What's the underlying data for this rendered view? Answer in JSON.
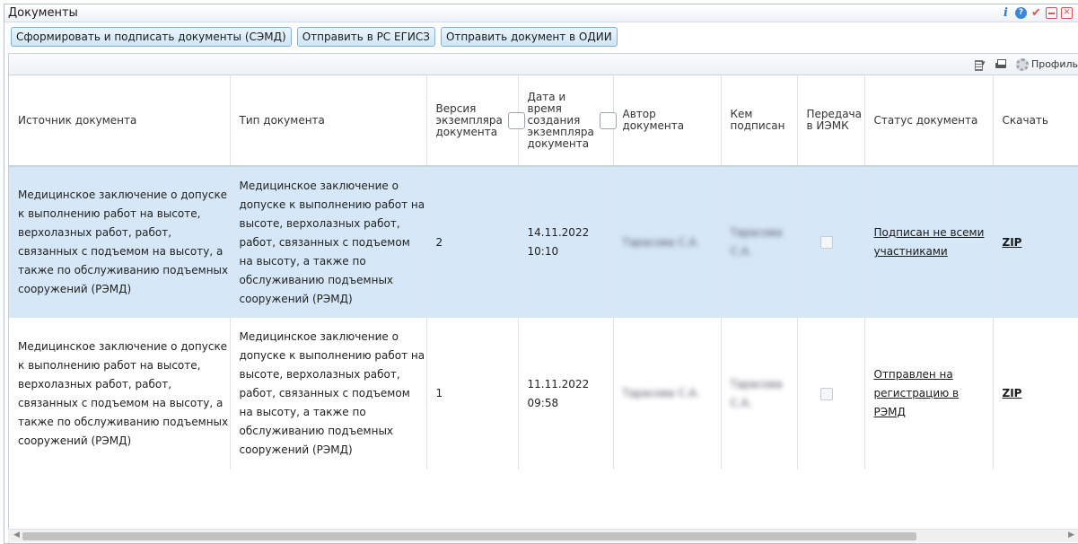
{
  "window": {
    "title": "Документы"
  },
  "actions": {
    "form_sign": "Сформировать и подписать документы (СЭМД)",
    "send_egisz": "Отправить в РС ЕГИСЗ",
    "send_odii": "Отправить документ в ОДИИ"
  },
  "grid_toolbar": {
    "profile_label": "Профиль"
  },
  "columns": {
    "source": "Источник документа",
    "type": "Тип документа",
    "version": "Версия экземпляра документа",
    "created": "Дата и время создания экземпляра документа",
    "author": "Автор документа",
    "signed_by": "Кем подписан",
    "iemk": "Передача в ИЭМК",
    "status": "Статус документа",
    "download": "Скачать"
  },
  "rows": [
    {
      "source": "Медицинское заключение о допуске к выполнению работ на высоте, верхолазных работ, работ, связанных с подъемом на высоту, а также по обслуживанию подъемных сооружений (РЭМД)",
      "type": "Медицинское заключение о допуске к выполнению работ на высоте, верхолазных работ, работ, связанных с подъемом на высоту, а также по обслуживанию подъемных сооружений (РЭМД)",
      "version": "2",
      "date": "14.11.2022",
      "time": "10:10",
      "author": "Тарасова С.А.",
      "signed_by": "Тарасова С.А.",
      "status": "Подписан не всеми участниками",
      "download": "ZIP",
      "selected": true
    },
    {
      "source": "Медицинское заключение о допуске к выполнению работ на высоте, верхолазных работ, работ, связанных с подъемом на высоту, а также по обслуживанию подъемных сооружений (РЭМД)",
      "type": "Медицинское заключение о допуске к выполнению работ на высоте, верхолазных работ, работ, связанных с подъемом на высоту, а также по обслуживанию подъемных сооружений (РЭМД)",
      "version": "1",
      "date": "11.11.2022",
      "time": "09:58",
      "author": "Тарасова С.А.",
      "signed_by": "Тарасова С.А.",
      "status": "Отправлен на регистрацию в РЭМД",
      "download": "ZIP",
      "selected": false
    }
  ],
  "colors": {
    "selected_row": "#d6e8f8",
    "button_border": "#7fb0d8",
    "titlebar_icon_red": "#d9534f",
    "info_blue": "#2b7cd3"
  }
}
